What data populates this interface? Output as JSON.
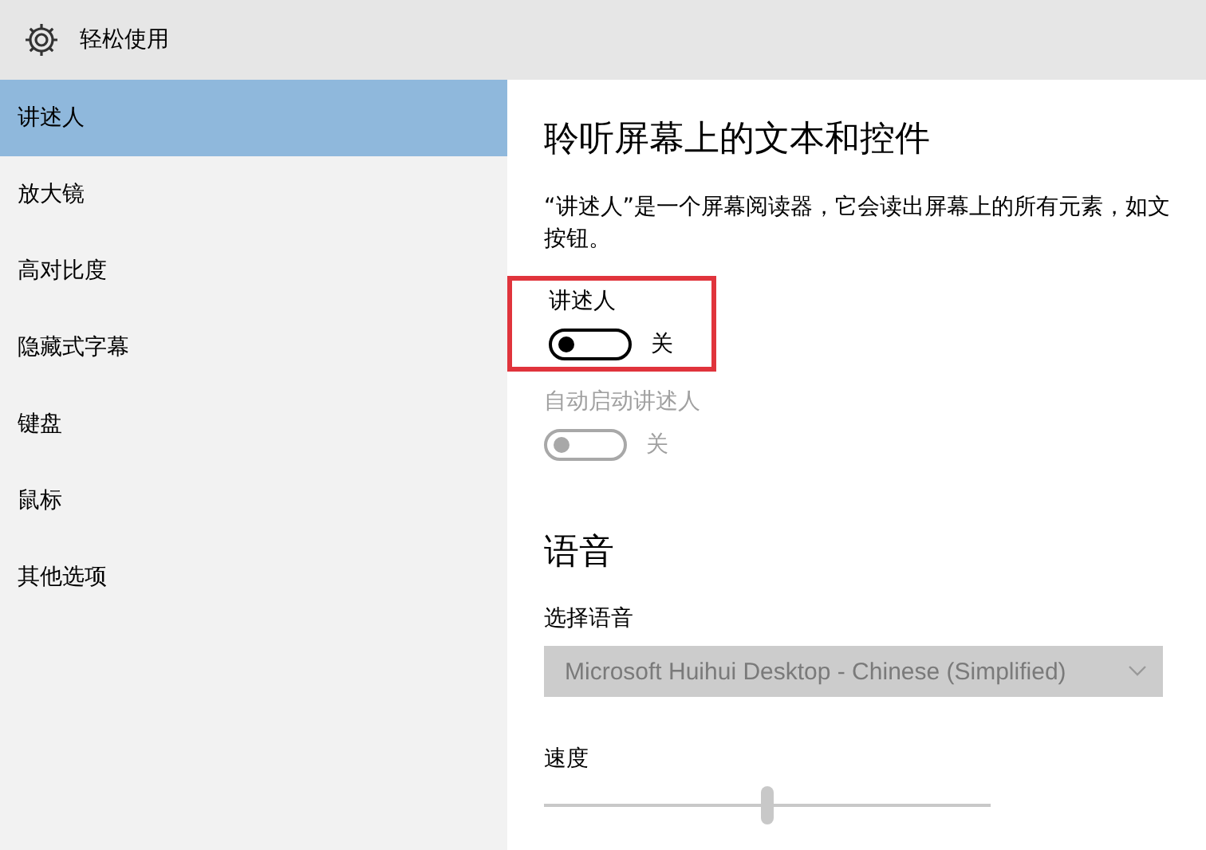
{
  "window": {
    "title": "轻松使用"
  },
  "sidebar": {
    "items": [
      {
        "label": "讲述人",
        "selected": true
      },
      {
        "label": "放大镜",
        "selected": false
      },
      {
        "label": "高对比度",
        "selected": false
      },
      {
        "label": "隐藏式字幕",
        "selected": false
      },
      {
        "label": "键盘",
        "selected": false
      },
      {
        "label": "鼠标",
        "selected": false
      },
      {
        "label": "其他选项",
        "selected": false
      }
    ]
  },
  "content": {
    "heading": "聆听屏幕上的文本和控件",
    "description": [
      "“讲述人”是一个屏幕阅读器，它会读出屏幕上的所有元素，如文",
      "按钮。"
    ],
    "toggles": [
      {
        "label": "讲述人",
        "on": false,
        "state_text": "关",
        "disabled": false,
        "highlighted": true
      },
      {
        "label": "自动启动讲述人",
        "on": false,
        "state_text": "关",
        "disabled": true,
        "highlighted": false
      }
    ],
    "voice_section": {
      "heading": "语音",
      "language_label": "选择语音",
      "language_value": "Microsoft Huihui Desktop - Chinese (Simplified)",
      "language_disabled": true,
      "speed_label": "速度",
      "speed_slider": {
        "level": 0.5,
        "disabled": true
      }
    }
  }
}
